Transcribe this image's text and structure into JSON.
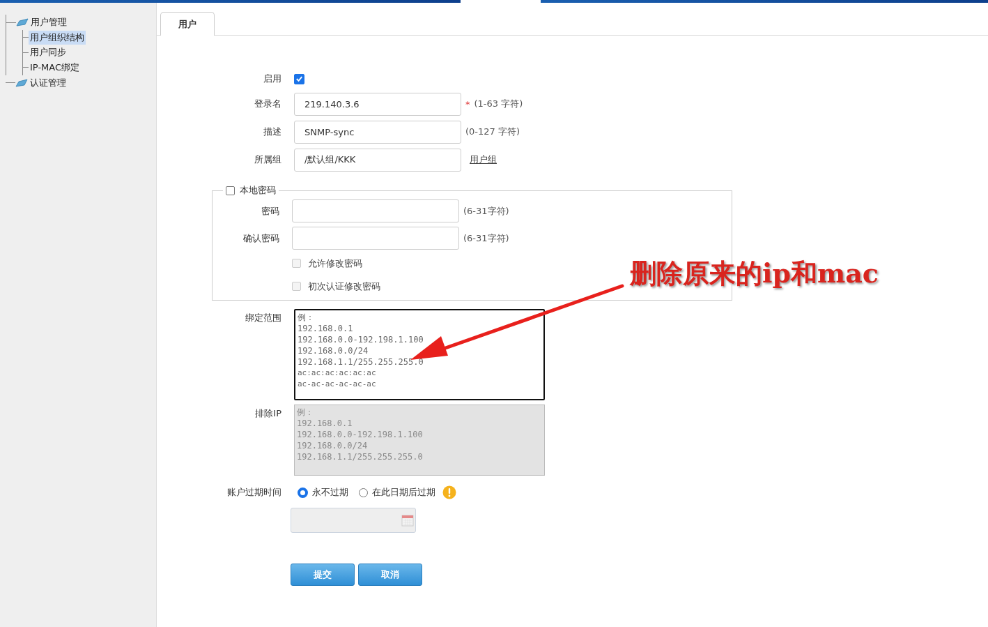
{
  "sidebar": {
    "items": [
      {
        "label": "用户管理",
        "selected": false,
        "children": [
          {
            "label": "用户组织结构",
            "selected": true
          },
          {
            "label": "用户同步",
            "selected": false
          },
          {
            "label": "IP-MAC绑定",
            "selected": false
          }
        ]
      },
      {
        "label": "认证管理",
        "selected": false
      }
    ]
  },
  "tabs": [
    {
      "label": "用户",
      "selected": true
    }
  ],
  "form": {
    "enable": {
      "label": "启用",
      "checked": true
    },
    "fields": [
      {
        "label": "登录名",
        "value": "219.140.3.6",
        "required_mark": "*",
        "hint": "(1-63 字符)"
      },
      {
        "label": "描述",
        "value": "SNMP-sync",
        "hint": "(0-127 字符)"
      },
      {
        "label": "所属组",
        "value": "/默认组/KKK",
        "link": "用户组"
      }
    ],
    "local_password": {
      "label": "本地密码",
      "checked": false,
      "fields": [
        {
          "label": "密码",
          "hint": "(6-31字符)"
        },
        {
          "label": "确认密码",
          "hint": "(6-31字符)"
        }
      ],
      "options": [
        {
          "label": "允许修改密码",
          "checked": false,
          "disabled": true
        },
        {
          "label": "初次认证修改密码",
          "checked": false,
          "disabled": true
        }
      ]
    },
    "bind_range": {
      "label": "绑定范围",
      "disabled": false,
      "focused": true,
      "placeholder": [
        "例：",
        "192.168.0.1",
        "192.168.0.0-192.198.1.100",
        "192.168.0.0/24",
        "192.168.1.1/255.255.255.0",
        "ac:ac:ac:ac:ac:ac",
        "ac-ac-ac-ac-ac-ac"
      ]
    },
    "exclude_ip": {
      "label": "排除IP",
      "disabled": true,
      "focused": false,
      "placeholder": [
        "例：",
        "192.168.0.1",
        "192.168.0.0-192.198.1.100",
        "192.168.0.0/24",
        "192.168.1.1/255.255.255.0"
      ]
    },
    "expiry": {
      "label": "账户过期时间",
      "options": [
        {
          "label": "永不过期",
          "selected": true
        },
        {
          "label": "在此日期后过期",
          "selected": false
        }
      ]
    },
    "buttons": [
      "提交",
      "取消"
    ]
  },
  "annotation": {
    "text": "删除原来的ip和mac"
  }
}
